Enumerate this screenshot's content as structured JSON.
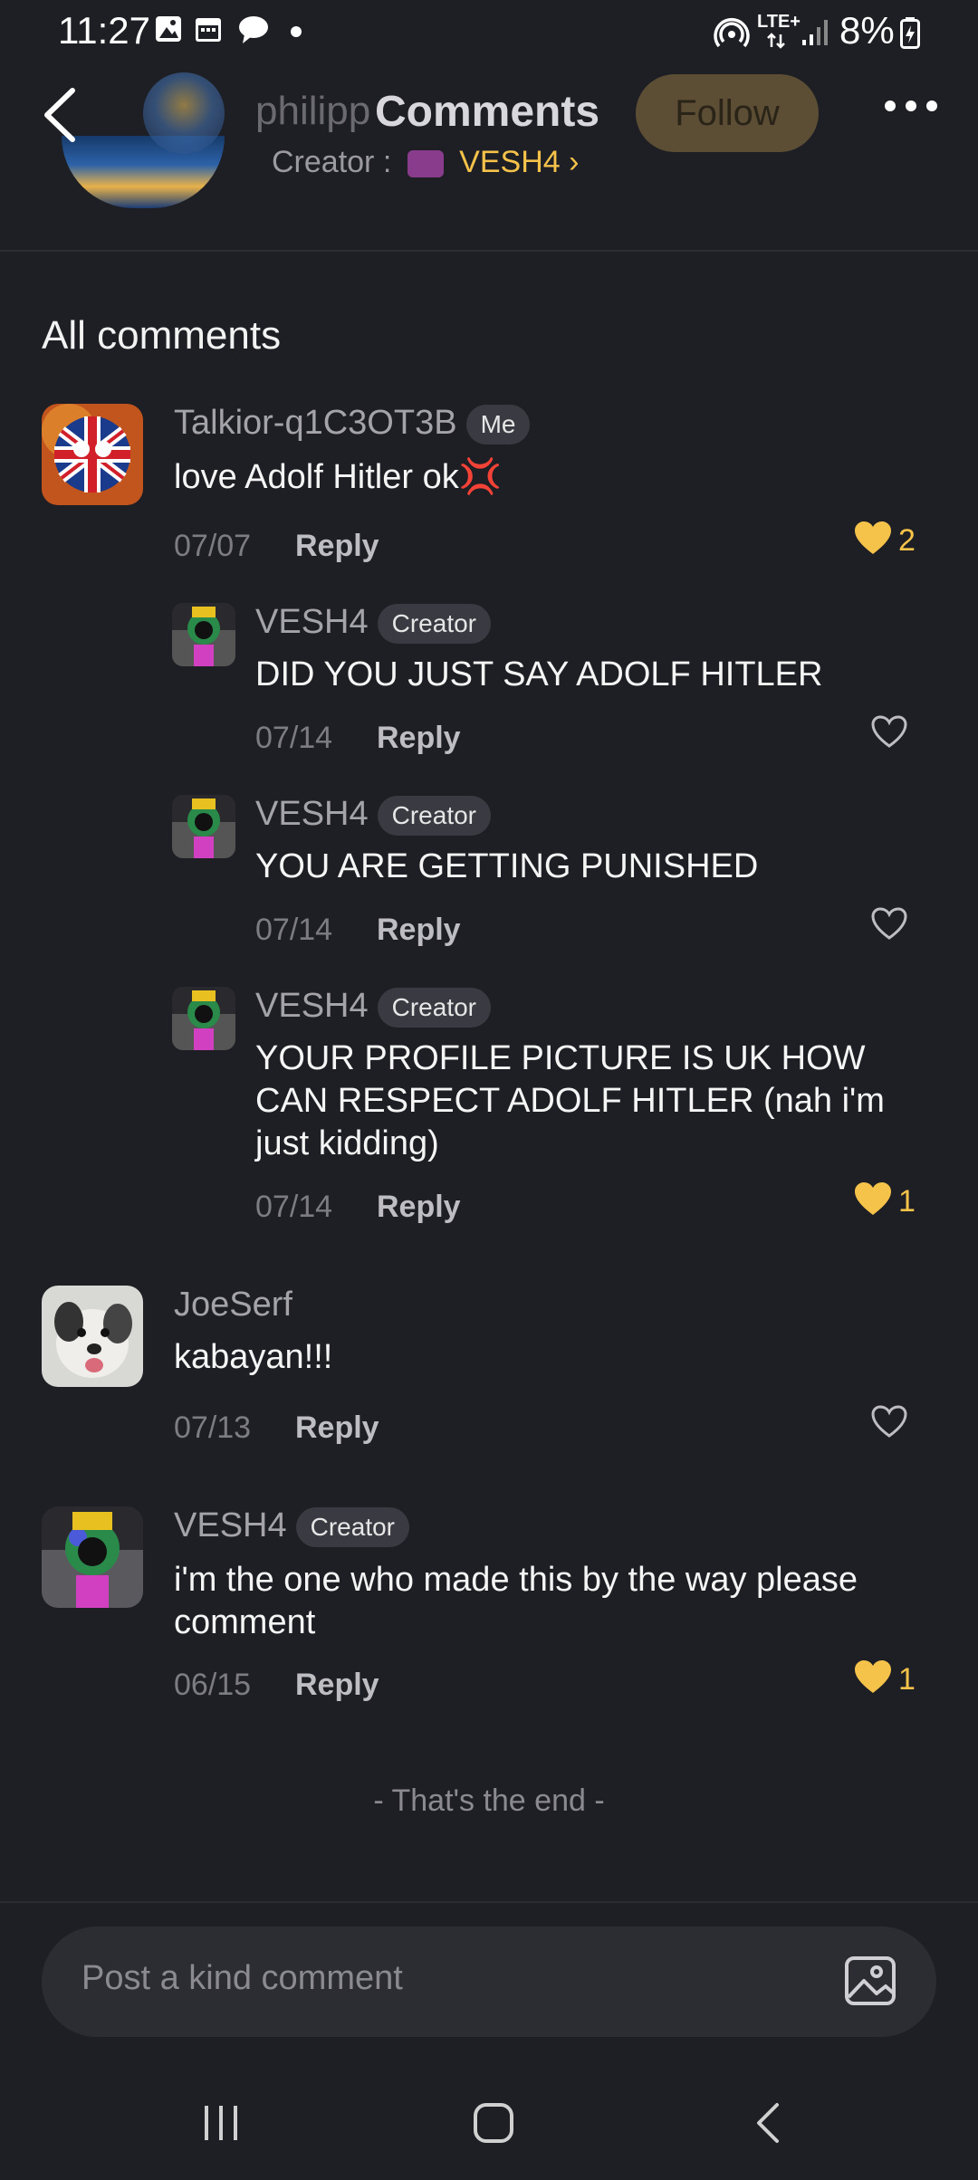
{
  "status_bar": {
    "time": "11:27",
    "network": "LTE+",
    "battery": "8%"
  },
  "header": {
    "username": "philipp",
    "title": "Comments",
    "follow_label": "Follow",
    "creator_label": "Creator :",
    "creator_name": "VESH4 ›"
  },
  "section_title": "All comments",
  "comments": [
    {
      "username": "Talkior-q1C3OT3B",
      "badge": "Me",
      "text": "love Adolf Hitler ok💢",
      "date": "07/07",
      "reply_label": "Reply",
      "likes": "2",
      "liked": true,
      "avatar": "uk-flag-avatar",
      "replies": [
        {
          "username": "VESH4",
          "badge": "Creator",
          "text": "DID YOU JUST SAY ADOLF HITLER",
          "date": "07/14",
          "reply_label": "Reply",
          "likes": "",
          "liked": false
        },
        {
          "username": "VESH4",
          "badge": "Creator",
          "text": "YOU ARE GETTING PUNISHED",
          "date": "07/14",
          "reply_label": "Reply",
          "likes": "",
          "liked": false
        },
        {
          "username": "VESH4",
          "badge": "Creator",
          "text": "YOUR PROFILE PICTURE IS UK HOW CAN RESPECT ADOLF HITLER (nah i'm just kidding)",
          "date": "07/14",
          "reply_label": "Reply",
          "likes": "1",
          "liked": true
        }
      ]
    },
    {
      "username": "JoeSerf",
      "badge": "",
      "text": "kabayan!!!",
      "date": "07/13",
      "reply_label": "Reply",
      "likes": "",
      "liked": false,
      "avatar": "dog-avatar"
    },
    {
      "username": "VESH4",
      "badge": "Creator",
      "text": "i'm the one who made this by the way please comment",
      "date": "06/15",
      "reply_label": "Reply",
      "likes": "1",
      "liked": true,
      "avatar": "vesh4-avatar"
    }
  ],
  "end_text": "- That's the end -",
  "input": {
    "placeholder": "Post a kind comment"
  },
  "colors": {
    "background": "#1e1f24",
    "accent": "#f5c24a",
    "follow_bg": "#5c4e35"
  }
}
